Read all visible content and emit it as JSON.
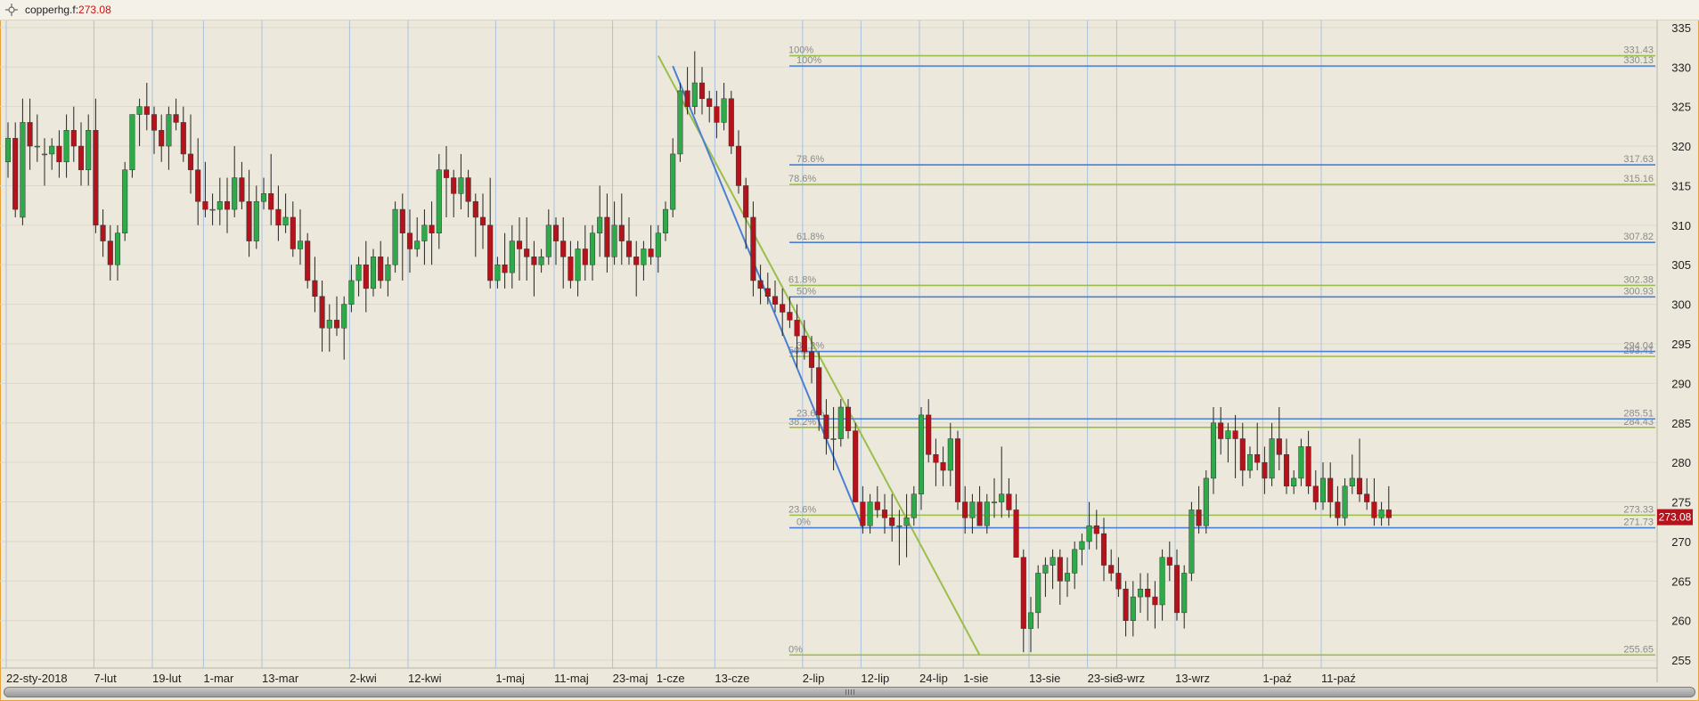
{
  "window": {
    "symbol_label": "copperhg.f:",
    "price_label": "273.08"
  },
  "colors": {
    "background": "#ece9dc",
    "grid": "#dcd9cc",
    "vgrid": "#a9c1de",
    "up": "#2eaa4a",
    "down": "#b5121b",
    "wick": "#222222",
    "fib_blue": "#4a7fd4",
    "fib_green": "#9bbd4a",
    "last_price_bg": "#b5121b"
  },
  "chart_data": {
    "type": "candlestick",
    "symbol": "copperhg.f",
    "last_price": 273.08,
    "ylim": [
      254,
      336
    ],
    "y_ticks": [
      335,
      330,
      325,
      320,
      315,
      310,
      305,
      300,
      295,
      290,
      285,
      280,
      275,
      270,
      265,
      260,
      255
    ],
    "x_labels": [
      {
        "i": 0,
        "label": "22-sty-2018"
      },
      {
        "i": 12,
        "label": "7-lut"
      },
      {
        "i": 20,
        "label": "19-lut"
      },
      {
        "i": 27,
        "label": "1-mar"
      },
      {
        "i": 35,
        "label": "13-mar"
      },
      {
        "i": 47,
        "label": "2-kwi"
      },
      {
        "i": 55,
        "label": "12-kwi"
      },
      {
        "i": 67,
        "label": "1-maj"
      },
      {
        "i": 75,
        "label": "11-maj"
      },
      {
        "i": 83,
        "label": "23-maj"
      },
      {
        "i": 89,
        "label": "1-cze"
      },
      {
        "i": 97,
        "label": "13-cze"
      },
      {
        "i": 109,
        "label": "2-lip"
      },
      {
        "i": 117,
        "label": "12-lip"
      },
      {
        "i": 125,
        "label": "24-lip"
      },
      {
        "i": 131,
        "label": "1-sie"
      },
      {
        "i": 140,
        "label": "13-sie"
      },
      {
        "i": 148,
        "label": "23-sie"
      },
      {
        "i": 152,
        "label": "3-wrz"
      },
      {
        "i": 160,
        "label": "13-wrz"
      },
      {
        "i": 172,
        "label": "1-paź"
      },
      {
        "i": 180,
        "label": "11-paź"
      }
    ],
    "candles": [
      [
        318,
        323,
        316,
        321
      ],
      [
        321,
        323,
        311,
        312
      ],
      [
        311,
        326,
        310,
        323
      ],
      [
        323,
        326,
        317,
        320
      ],
      [
        320,
        324,
        318,
        320
      ],
      [
        319,
        321,
        315,
        319
      ],
      [
        319,
        321,
        317,
        320
      ],
      [
        320,
        322,
        316,
        318
      ],
      [
        318,
        324,
        316,
        322
      ],
      [
        322,
        325,
        318,
        320
      ],
      [
        320,
        323,
        315,
        317
      ],
      [
        317,
        324,
        315,
        322
      ],
      [
        322,
        326,
        309,
        310
      ],
      [
        310,
        312,
        306,
        308
      ],
      [
        308,
        310,
        303,
        305
      ],
      [
        305,
        310,
        303,
        309
      ],
      [
        309,
        318,
        308,
        317
      ],
      [
        317,
        324,
        316,
        324
      ],
      [
        324,
        326,
        320,
        325
      ],
      [
        325,
        328,
        322,
        324
      ],
      [
        324,
        325,
        319,
        322
      ],
      [
        322,
        324,
        318,
        320
      ],
      [
        320,
        325,
        317,
        324
      ],
      [
        324,
        326,
        322,
        323
      ],
      [
        323,
        325,
        318,
        319
      ],
      [
        319,
        324,
        314,
        317
      ],
      [
        317,
        321,
        310,
        313
      ],
      [
        313,
        318,
        311,
        312
      ],
      [
        312,
        314,
        310,
        312
      ],
      [
        312,
        316,
        310,
        313
      ],
      [
        313,
        316,
        309,
        312
      ],
      [
        312,
        320,
        311,
        316
      ],
      [
        316,
        318,
        312,
        313
      ],
      [
        313,
        317,
        306,
        308
      ],
      [
        308,
        315,
        307,
        313
      ],
      [
        313,
        316,
        312,
        314
      ],
      [
        314,
        319,
        310,
        312
      ],
      [
        312,
        315,
        308,
        310
      ],
      [
        310,
        314,
        309,
        311
      ],
      [
        311,
        313,
        306,
        307
      ],
      [
        307,
        312,
        305,
        308
      ],
      [
        308,
        309,
        302,
        303
      ],
      [
        303,
        306,
        299,
        301
      ],
      [
        301,
        303,
        294,
        297
      ],
      [
        297,
        300,
        294,
        298
      ],
      [
        298,
        301,
        296,
        297
      ],
      [
        297,
        301,
        293,
        300
      ],
      [
        300,
        305,
        299,
        303
      ],
      [
        303,
        306,
        301,
        305
      ],
      [
        305,
        308,
        299,
        302
      ],
      [
        302,
        307,
        301,
        306
      ],
      [
        306,
        308,
        302,
        303
      ],
      [
        303,
        306,
        301,
        305
      ],
      [
        305,
        313,
        304,
        312
      ],
      [
        312,
        314,
        303,
        309
      ],
      [
        309,
        312,
        304,
        307
      ],
      [
        307,
        311,
        306,
        308
      ],
      [
        308,
        312,
        305,
        310
      ],
      [
        310,
        313,
        305,
        309
      ],
      [
        309,
        319,
        307,
        317
      ],
      [
        317,
        320,
        311,
        316
      ],
      [
        316,
        317,
        311,
        314
      ],
      [
        314,
        319,
        312,
        316
      ],
      [
        316,
        317,
        311,
        313
      ],
      [
        313,
        314,
        306,
        311
      ],
      [
        311,
        314,
        307,
        310
      ],
      [
        310,
        316,
        302,
        303
      ],
      [
        303,
        306,
        302,
        305
      ],
      [
        305,
        309,
        302,
        304
      ],
      [
        304,
        310,
        302,
        308
      ],
      [
        308,
        311,
        303,
        307
      ],
      [
        307,
        311,
        303,
        306
      ],
      [
        306,
        308,
        301,
        305
      ],
      [
        305,
        307,
        304,
        306
      ],
      [
        306,
        312,
        305,
        310
      ],
      [
        310,
        311,
        305,
        308
      ],
      [
        308,
        311,
        302,
        306
      ],
      [
        306,
        308,
        302,
        303
      ],
      [
        303,
        308,
        301,
        307
      ],
      [
        307,
        310,
        303,
        305
      ],
      [
        305,
        310,
        303,
        309
      ],
      [
        309,
        315,
        306,
        311
      ],
      [
        311,
        314,
        304,
        306
      ],
      [
        306,
        313,
        305,
        310
      ],
      [
        310,
        314,
        305,
        308
      ],
      [
        308,
        311,
        305,
        306
      ],
      [
        306,
        308,
        301,
        305
      ],
      [
        305,
        308,
        303,
        307
      ],
      [
        307,
        310,
        305,
        306
      ],
      [
        306,
        310,
        304,
        309
      ],
      [
        309,
        313,
        308,
        312
      ],
      [
        312,
        321,
        311,
        319
      ],
      [
        319,
        328,
        318,
        327
      ],
      [
        327,
        330,
        324,
        325
      ],
      [
        325,
        332,
        324,
        328
      ],
      [
        328,
        330,
        324,
        326
      ],
      [
        326,
        327,
        323,
        325
      ],
      [
        325,
        327,
        321,
        323
      ],
      [
        323,
        328,
        322,
        326
      ],
      [
        326,
        327,
        319,
        320
      ],
      [
        320,
        322,
        314,
        315
      ],
      [
        315,
        316,
        307,
        311
      ],
      [
        311,
        313,
        301,
        303
      ],
      [
        303,
        305,
        300,
        302
      ],
      [
        302,
        304,
        300,
        301
      ],
      [
        301,
        303,
        299,
        300
      ],
      [
        300,
        302,
        296,
        299
      ],
      [
        299,
        301,
        297,
        298
      ],
      [
        298,
        300,
        292,
        296
      ],
      [
        296,
        298,
        293,
        294
      ],
      [
        294,
        296,
        290,
        292
      ],
      [
        292,
        294,
        284,
        286
      ],
      [
        286,
        288,
        281,
        283
      ],
      [
        283,
        287,
        279,
        283
      ],
      [
        283,
        288,
        282,
        287
      ],
      [
        287,
        288,
        283,
        284
      ],
      [
        284,
        285,
        275,
        275
      ],
      [
        275,
        277,
        271,
        272
      ],
      [
        272,
        276,
        271,
        275
      ],
      [
        275,
        277,
        273,
        274
      ],
      [
        274,
        276,
        271,
        273
      ],
      [
        273,
        276,
        270,
        272
      ],
      [
        272,
        274,
        267,
        272
      ],
      [
        272,
        276,
        268,
        273
      ],
      [
        273,
        277,
        272,
        276
      ],
      [
        276,
        287,
        274,
        286
      ],
      [
        286,
        288,
        280,
        281
      ],
      [
        281,
        283,
        277,
        280
      ],
      [
        280,
        282,
        277,
        279
      ],
      [
        279,
        285,
        277,
        283
      ],
      [
        283,
        284,
        274,
        275
      ],
      [
        275,
        277,
        271,
        273
      ],
      [
        273,
        276,
        271,
        275
      ],
      [
        275,
        277,
        272,
        272
      ],
      [
        272,
        276,
        271,
        275
      ],
      [
        275,
        278,
        273,
        275
      ],
      [
        275,
        282,
        273,
        276
      ],
      [
        276,
        278,
        273,
        274
      ],
      [
        274,
        276,
        268,
        268
      ],
      [
        268,
        269,
        256,
        259
      ],
      [
        259,
        263,
        256,
        261
      ],
      [
        261,
        267,
        259,
        266
      ],
      [
        266,
        268,
        263,
        267
      ],
      [
        267,
        269,
        264,
        268
      ],
      [
        268,
        269,
        262,
        265
      ],
      [
        265,
        268,
        263,
        266
      ],
      [
        266,
        270,
        264,
        269
      ],
      [
        269,
        271,
        267,
        270
      ],
      [
        270,
        275,
        269,
        272
      ],
      [
        272,
        274,
        269,
        271
      ],
      [
        271,
        273,
        265,
        267
      ],
      [
        267,
        269,
        265,
        266
      ],
      [
        266,
        268,
        263,
        264
      ],
      [
        264,
        265,
        258,
        260
      ],
      [
        260,
        265,
        258,
        263
      ],
      [
        263,
        266,
        261,
        264
      ],
      [
        264,
        266,
        260,
        263
      ],
      [
        263,
        265,
        259,
        262
      ],
      [
        262,
        269,
        260,
        268
      ],
      [
        268,
        270,
        265,
        267
      ],
      [
        267,
        269,
        260,
        261
      ],
      [
        261,
        267,
        259,
        266
      ],
      [
        266,
        275,
        265,
        274
      ],
      [
        274,
        277,
        271,
        272
      ],
      [
        272,
        279,
        271,
        278
      ],
      [
        278,
        287,
        276,
        285
      ],
      [
        285,
        287,
        281,
        283
      ],
      [
        283,
        285,
        280,
        284
      ],
      [
        284,
        286,
        278,
        283
      ],
      [
        283,
        285,
        277,
        279
      ],
      [
        279,
        282,
        278,
        281
      ],
      [
        281,
        285,
        279,
        280
      ],
      [
        280,
        282,
        276,
        278
      ],
      [
        278,
        285,
        277,
        283
      ],
      [
        283,
        287,
        279,
        281
      ],
      [
        281,
        283,
        276,
        277
      ],
      [
        277,
        279,
        276,
        278
      ],
      [
        278,
        283,
        277,
        282
      ],
      [
        282,
        284,
        276,
        277
      ],
      [
        277,
        279,
        274,
        275
      ],
      [
        275,
        280,
        274,
        278
      ],
      [
        278,
        280,
        273,
        275
      ],
      [
        275,
        277,
        272,
        273
      ],
      [
        273,
        278,
        272,
        277
      ],
      [
        277,
        281,
        276,
        278
      ],
      [
        278,
        283,
        275,
        276
      ],
      [
        276,
        278,
        274,
        275
      ],
      [
        275,
        278,
        272,
        273
      ],
      [
        273,
        275,
        272,
        274
      ],
      [
        274,
        277,
        272,
        273
      ]
    ],
    "fib_blue": {
      "from": {
        "i": 91,
        "price": 330.13
      },
      "to": {
        "i": 117,
        "price": 271.73
      },
      "levels": [
        {
          "pct": "0%",
          "value": 271.73,
          "label": "271.73"
        },
        {
          "pct": "23.6%",
          "value": 285.51,
          "label": "285.51"
        },
        {
          "pct": "38.2%",
          "value": 294.04,
          "label": "294.04"
        },
        {
          "pct": "50%",
          "value": 300.93,
          "label": "300.93"
        },
        {
          "pct": "61.8%",
          "value": 307.82,
          "label": "307.82"
        },
        {
          "pct": "78.6%",
          "value": 317.63,
          "label": "317.63"
        },
        {
          "pct": "100%",
          "value": 330.13,
          "label": "330.13"
        }
      ]
    },
    "fib_green": {
      "from": {
        "i": 89,
        "price": 331.43
      },
      "to": {
        "i": 133,
        "price": 255.65
      },
      "levels": [
        {
          "pct": "0%",
          "value": 255.65,
          "label": "255.65"
        },
        {
          "pct": "23.6%",
          "value": 273.33,
          "label": "273.33"
        },
        {
          "pct": "38.2%",
          "value": 284.43,
          "label": "284.43"
        },
        {
          "pct": "50%",
          "value": 293.41,
          "label": "293.41"
        },
        {
          "pct": "61.8%",
          "value": 302.38,
          "label": "302.38"
        },
        {
          "pct": "78.6%",
          "value": 315.16,
          "label": "315.16"
        },
        {
          "pct": "100%",
          "value": 331.43,
          "label": "331.43"
        }
      ]
    }
  }
}
